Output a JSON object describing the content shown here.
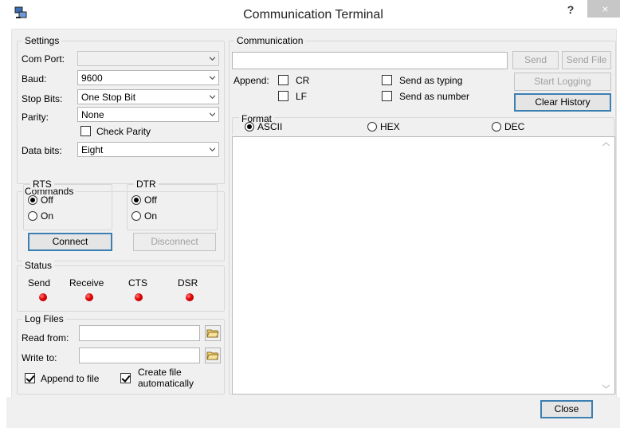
{
  "window": {
    "title": "Communication Terminal",
    "help_label": "?",
    "close_glyph": "×"
  },
  "settings": {
    "legend": "Settings",
    "com_port": {
      "label": "Com Port:",
      "value": ""
    },
    "baud": {
      "label": "Baud:",
      "value": "9600"
    },
    "stop_bits": {
      "label": "Stop Bits:",
      "value": "One Stop Bit"
    },
    "parity": {
      "label": "Parity:",
      "value": "None"
    },
    "check_parity": {
      "label": "Check Parity",
      "checked": false
    },
    "data_bits": {
      "label": "Data bits:",
      "value": "Eight"
    }
  },
  "commands": {
    "legend": "Commands",
    "rts": {
      "legend": "RTS",
      "off": "Off",
      "on": "On",
      "selected": "Off"
    },
    "dtr": {
      "legend": "DTR",
      "off": "Off",
      "on": "On",
      "selected": "Off"
    },
    "connect_label": "Connect",
    "disconnect_label": "Disconnect"
  },
  "status": {
    "legend": "Status",
    "indicators": [
      {
        "label": "Send",
        "color": "#e00000"
      },
      {
        "label": "Receive",
        "color": "#e00000"
      },
      {
        "label": "CTS",
        "color": "#e00000"
      },
      {
        "label": "DSR",
        "color": "#e00000"
      }
    ]
  },
  "log_files": {
    "legend": "Log Files",
    "read_from": {
      "label": "Read from:",
      "value": ""
    },
    "write_to": {
      "label": "Write to:",
      "value": ""
    },
    "append_to_file": {
      "label": "Append to file",
      "checked": true
    },
    "create_file": {
      "label_line1": "Create file",
      "label_line2": "automatically",
      "checked": true
    }
  },
  "communication": {
    "legend": "Communication",
    "send_text": "",
    "send_label": "Send",
    "send_file_label": "Send File",
    "append_label": "Append:",
    "cr_label": "CR",
    "lf_label": "LF",
    "send_as_typing_label": "Send as typing",
    "send_as_number_label": "Send as number",
    "start_logging_label": "Start Logging",
    "clear_history_label": "Clear History",
    "format": {
      "legend": "Format",
      "ascii": "ASCII",
      "hex": "HEX",
      "dec": "DEC",
      "selected": "ASCII"
    },
    "history_text": ""
  },
  "footer": {
    "close_label": "Close"
  },
  "colors": {
    "accent": "#3c7fb1",
    "led_red": "#e00000",
    "panel_bg": "#f0f0f0"
  }
}
